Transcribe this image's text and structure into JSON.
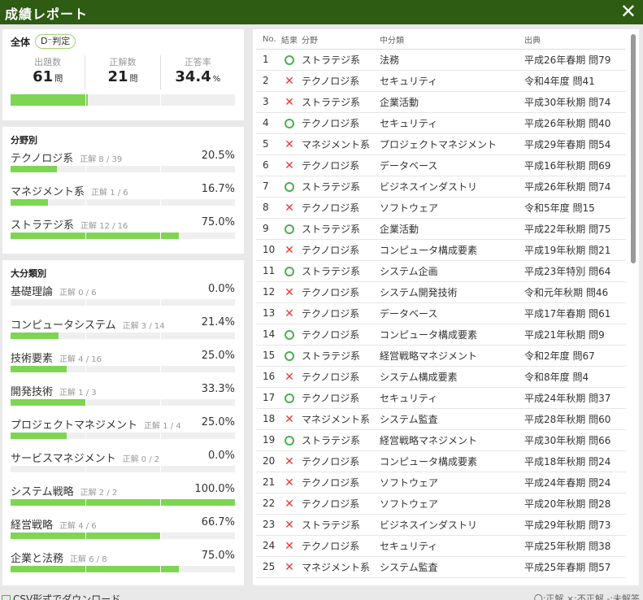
{
  "window": {
    "title": "成績レポート",
    "close_icon": "close-icon"
  },
  "overall": {
    "label": "全体",
    "grade": "D⁻判定",
    "stats": [
      {
        "caption": "出題数",
        "value": "61",
        "unit": "問"
      },
      {
        "caption": "正解数",
        "value": "21",
        "unit": "問"
      },
      {
        "caption": "正答率",
        "value": "34.4",
        "unit": "%"
      }
    ],
    "progress": 0.344
  },
  "by_field": {
    "title": "分野別",
    "items": [
      {
        "name": "テクノロジ系",
        "sub": "正解 8 / 39",
        "pct": "20.5%",
        "ratio": 0.205
      },
      {
        "name": "マネジメント系",
        "sub": "正解 1 / 6",
        "pct": "16.7%",
        "ratio": 0.167
      },
      {
        "name": "ストラテジ系",
        "sub": "正解 12 / 16",
        "pct": "75.0%",
        "ratio": 0.75
      }
    ]
  },
  "by_major": {
    "title": "大分類別",
    "items": [
      {
        "name": "基礎理論",
        "sub": "正解 0 / 6",
        "pct": "0.0%",
        "ratio": 0.0
      },
      {
        "name": "コンピュータシステム",
        "sub": "正解 3 / 14",
        "pct": "21.4%",
        "ratio": 0.214
      },
      {
        "name": "技術要素",
        "sub": "正解 4 / 16",
        "pct": "25.0%",
        "ratio": 0.25
      },
      {
        "name": "開発技術",
        "sub": "正解 1 / 3",
        "pct": "33.3%",
        "ratio": 0.333
      },
      {
        "name": "プロジェクトマネジメント",
        "sub": "正解 1 / 4",
        "pct": "25.0%",
        "ratio": 0.25
      },
      {
        "name": "サービスマネジメント",
        "sub": "正解 0 / 2",
        "pct": "0.0%",
        "ratio": 0.0
      },
      {
        "name": "システム戦略",
        "sub": "正解 2 / 2",
        "pct": "100.0%",
        "ratio": 1.0
      },
      {
        "name": "経営戦略",
        "sub": "正解 4 / 6",
        "pct": "66.7%",
        "ratio": 0.667
      },
      {
        "name": "企業と法務",
        "sub": "正解 6 / 8",
        "pct": "75.0%",
        "ratio": 0.75
      }
    ]
  },
  "table": {
    "headers": {
      "no": "No.",
      "result": "結果",
      "field": "分野",
      "mid": "中分類",
      "source": "出典"
    },
    "rows": [
      {
        "no": "1",
        "result": "o",
        "field": "ストラテジ系",
        "mid": "法務",
        "source": "平成26年春期 問79"
      },
      {
        "no": "2",
        "result": "x",
        "field": "テクノロジ系",
        "mid": "セキュリティ",
        "source": "令和4年度 問41"
      },
      {
        "no": "3",
        "result": "x",
        "field": "ストラテジ系",
        "mid": "企業活動",
        "source": "平成30年秋期 問74"
      },
      {
        "no": "4",
        "result": "o",
        "field": "テクノロジ系",
        "mid": "セキュリティ",
        "source": "平成26年秋期 問40"
      },
      {
        "no": "5",
        "result": "x",
        "field": "マネジメント系",
        "mid": "プロジェクトマネジメント",
        "source": "平成29年春期 問54"
      },
      {
        "no": "6",
        "result": "x",
        "field": "テクノロジ系",
        "mid": "データベース",
        "source": "平成16年秋期 問69"
      },
      {
        "no": "7",
        "result": "o",
        "field": "ストラテジ系",
        "mid": "ビジネスインダストリ",
        "source": "平成26年秋期 問74"
      },
      {
        "no": "8",
        "result": "x",
        "field": "テクノロジ系",
        "mid": "ソフトウェア",
        "source": "令和5年度 問15"
      },
      {
        "no": "9",
        "result": "o",
        "field": "ストラテジ系",
        "mid": "企業活動",
        "source": "平成22年秋期 問75"
      },
      {
        "no": "10",
        "result": "x",
        "field": "テクノロジ系",
        "mid": "コンピュータ構成要素",
        "source": "平成19年秋期 問21"
      },
      {
        "no": "11",
        "result": "o",
        "field": "ストラテジ系",
        "mid": "システム企画",
        "source": "平成23年特別 問64"
      },
      {
        "no": "12",
        "result": "x",
        "field": "テクノロジ系",
        "mid": "システム開発技術",
        "source": "令和元年秋期 問46"
      },
      {
        "no": "13",
        "result": "x",
        "field": "テクノロジ系",
        "mid": "データベース",
        "source": "平成17年春期 問61"
      },
      {
        "no": "14",
        "result": "o",
        "field": "テクノロジ系",
        "mid": "コンピュータ構成要素",
        "source": "平成21年秋期 問9"
      },
      {
        "no": "15",
        "result": "o",
        "field": "ストラテジ系",
        "mid": "経営戦略マネジメント",
        "source": "令和2年度 問67"
      },
      {
        "no": "16",
        "result": "x",
        "field": "テクノロジ系",
        "mid": "システム構成要素",
        "source": "令和8年度 問4"
      },
      {
        "no": "17",
        "result": "o",
        "field": "テクノロジ系",
        "mid": "セキュリティ",
        "source": "平成24年秋期 問37"
      },
      {
        "no": "18",
        "result": "x",
        "field": "マネジメント系",
        "mid": "システム監査",
        "source": "平成28年秋期 問60"
      },
      {
        "no": "19",
        "result": "o",
        "field": "ストラテジ系",
        "mid": "経営戦略マネジメント",
        "source": "平成30年秋期 問66"
      },
      {
        "no": "20",
        "result": "x",
        "field": "テクノロジ系",
        "mid": "コンピュータ構成要素",
        "source": "平成18年秋期 問24"
      },
      {
        "no": "21",
        "result": "x",
        "field": "テクノロジ系",
        "mid": "ソフトウェア",
        "source": "平成24年春期 問24"
      },
      {
        "no": "22",
        "result": "x",
        "field": "テクノロジ系",
        "mid": "ソフトウェア",
        "source": "平成20年秋期 問28"
      },
      {
        "no": "23",
        "result": "x",
        "field": "ストラテジ系",
        "mid": "ビジネスインダストリ",
        "source": "平成29年秋期 問73"
      },
      {
        "no": "24",
        "result": "x",
        "field": "テクノロジ系",
        "mid": "セキュリティ",
        "source": "平成25年秋期 問38"
      },
      {
        "no": "25",
        "result": "x",
        "field": "マネジメント系",
        "mid": "システム監査",
        "source": "平成25年春期 問57"
      }
    ]
  },
  "footer": {
    "csv_label": "CSV形式でダウンロード",
    "legend": "〇:正解 ×:不正解 -:未解答"
  },
  "colors": {
    "header_bg": "#2e5c12",
    "bar_fill": "#7ed552",
    "correct": "#4caf50",
    "wrong": "#e53935"
  }
}
